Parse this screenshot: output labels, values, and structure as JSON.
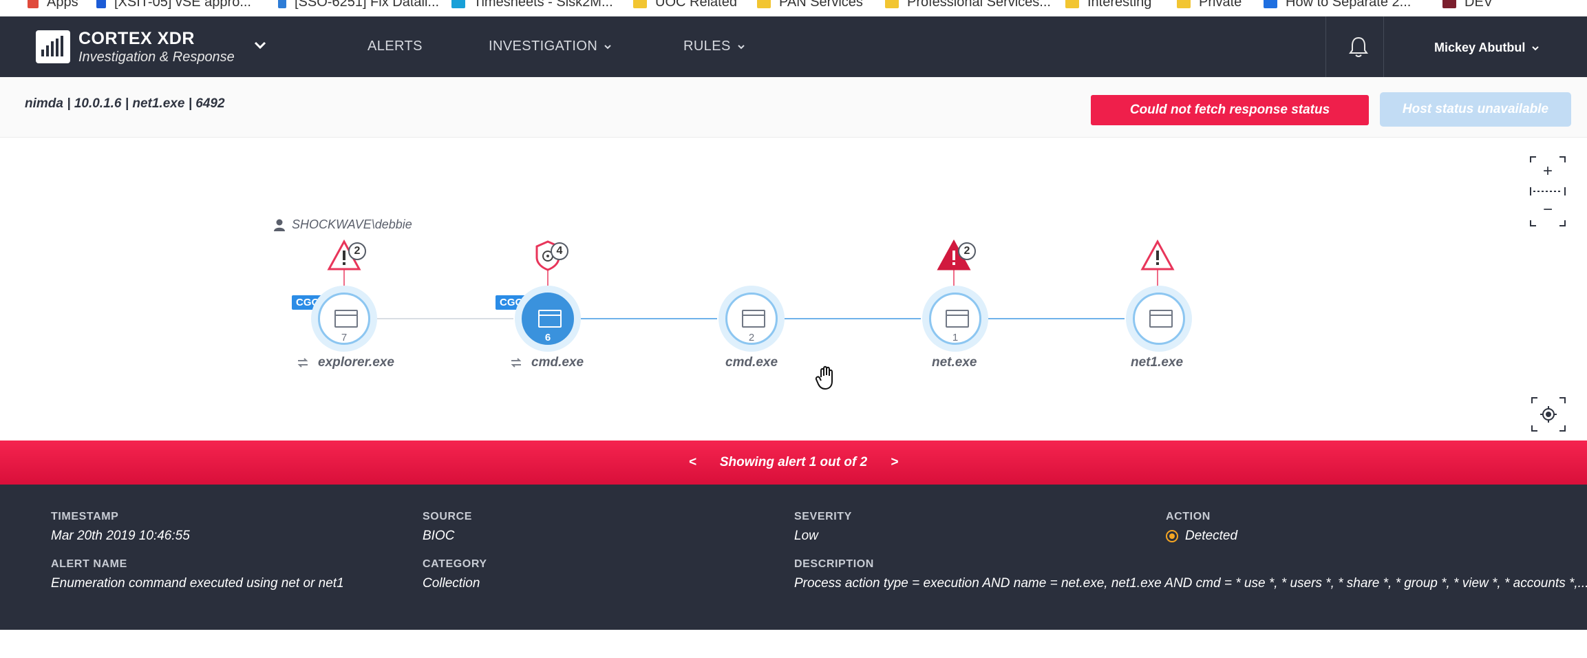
{
  "bookmarks": [
    {
      "label": "Apps",
      "color": "#e04a3b"
    },
    {
      "label": "[XSIT-05] vSE appro...",
      "color": "#1c5bd6"
    },
    {
      "label": "[SSO-6251] Fix Datali...",
      "color": "#2d7cd6"
    },
    {
      "label": "Timesheets - Sisk2M...",
      "color": "#18a0d8"
    },
    {
      "label": "UOC Related",
      "color": "#f2c531"
    },
    {
      "label": "PAN Services",
      "color": "#f2c531"
    },
    {
      "label": "Professional Services...",
      "color": "#f2c531"
    },
    {
      "label": "Interesting",
      "color": "#f2c531"
    },
    {
      "label": "Private",
      "color": "#f2c531"
    },
    {
      "label": "How to Separate 2...",
      "color": "#1f6fe0"
    },
    {
      "label": "DEV",
      "color": "#7b1f2e"
    }
  ],
  "header": {
    "brand_title": "CORTEX XDR",
    "brand_subtitle": "Investigation & Response",
    "nav": {
      "alerts": "ALERTS",
      "investigation": "INVESTIGATION",
      "rules": "RULES"
    },
    "user_name": "Mickey Abutbul"
  },
  "context": {
    "path": "nimda  |  10.0.1.6  |  net1.exe  |  6492",
    "error_status": "Could not fetch response status",
    "host_status": "Host status unavailable"
  },
  "graph": {
    "user": "SHOCKWAVE\\debbie",
    "nodes": [
      {
        "name": "explorer.exe",
        "count": "7",
        "cgo": "CGO",
        "alert_count": "2"
      },
      {
        "name": "cmd.exe",
        "count": "6",
        "cgo": "CGO",
        "alert_count": "4"
      },
      {
        "name": "cmd.exe",
        "count": "2"
      },
      {
        "name": "net.exe",
        "count": "1",
        "alert_count": "2"
      },
      {
        "name": "net1.exe",
        "count": ""
      }
    ],
    "zoom_in": "+",
    "zoom_out": "−"
  },
  "pager": {
    "prev": "<",
    "text": "Showing alert 1 out of 2",
    "next": ">"
  },
  "details": {
    "timestamp_label": "TIMESTAMP",
    "timestamp": "Mar 20th 2019 10:46:55",
    "source_label": "SOURCE",
    "source": "BIOC",
    "severity_label": "SEVERITY",
    "severity": "Low",
    "action_label": "ACTION",
    "action": "Detected",
    "alert_name_label": "ALERT NAME",
    "alert_name": "Enumeration command executed using net or net1",
    "category_label": "CATEGORY",
    "category": "Collection",
    "description_label": "DESCRIPTION",
    "description": "Process action type = execution AND name = net.exe, net1.exe AND cmd = * use *, * users *, * share *, * group *, * view *, * accounts *,..."
  },
  "colors": {
    "header_bg": "#2a2f3c",
    "alert_red": "#ef1f4b",
    "node_blue": "#3a92dd",
    "action_orange": "#f5a623"
  }
}
